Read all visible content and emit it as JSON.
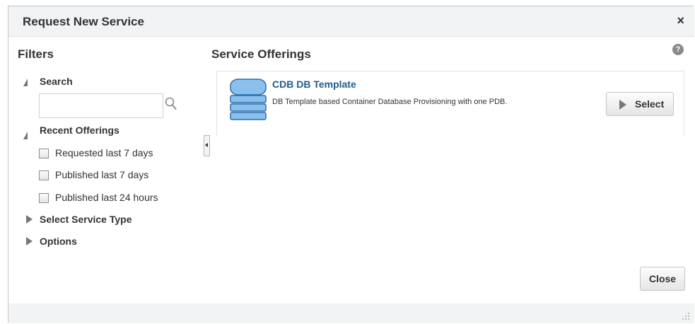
{
  "dialog": {
    "title": "Request New Service",
    "close_glyph": "×"
  },
  "filters": {
    "heading": "Filters",
    "search": {
      "label": "Search",
      "value": "",
      "placeholder": "",
      "icon": "search-icon"
    },
    "recent_offerings": {
      "label": "Recent Offerings",
      "items": [
        {
          "label": "Requested last 7 days",
          "checked": false
        },
        {
          "label": "Published last 7 days",
          "checked": false
        },
        {
          "label": "Published last 24 hours",
          "checked": false
        }
      ]
    },
    "select_service_type": {
      "label": "Select Service Type"
    },
    "options": {
      "label": "Options"
    }
  },
  "offerings": {
    "heading": "Service Offerings",
    "help_glyph": "?",
    "items": [
      {
        "name": "CDB DB Template",
        "description": "DB Template based Container Database Provisioning with one PDB.",
        "icon": "database-icon",
        "select_label": "Select"
      }
    ]
  },
  "footer": {
    "close_label": "Close"
  },
  "colors": {
    "title_bar": "#f1f3f4",
    "link": "#1f5c8c",
    "db_icon_fill": "#8cc0ec",
    "db_icon_stroke": "#2c6fad"
  }
}
